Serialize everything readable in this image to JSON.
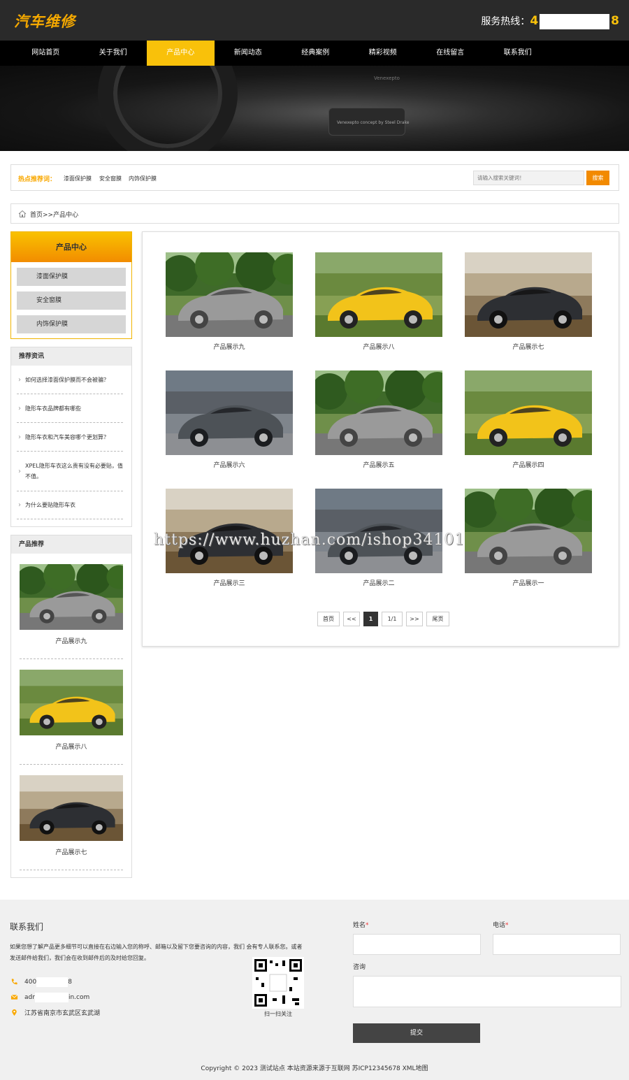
{
  "header": {
    "logo": "汽车维修",
    "hotline_label": "服务热线：",
    "hotline_start": "4",
    "hotline_end": "8"
  },
  "nav": {
    "items": [
      "网站首页",
      "关于我们",
      "产品中心",
      "新闻动态",
      "经典案例",
      "精彩视频",
      "在线留言",
      "联系我们"
    ],
    "active_index": 2
  },
  "banner": {
    "caption": "Venexepto concept by Steel Drake",
    "caption2": "Venexepto"
  },
  "hot_search": {
    "label": "热点推荐词：",
    "keywords": [
      "漆面保护膜",
      "安全窗膜",
      "内饰保护膜"
    ],
    "search_placeholder": "请输入搜索关键词！",
    "search_button": "搜索"
  },
  "breadcrumb": {
    "text": "首页>>产品中心"
  },
  "sidebar": {
    "category_title": "产品中心",
    "categories": [
      "漆面保护膜",
      "安全窗膜",
      "内饰保护膜"
    ],
    "news_title": "推荐资讯",
    "news": [
      "如何选择漆面保护膜而不会被骗？",
      "隐形车衣品牌都有哪些",
      "隐形车衣和汽车美容哪个更划算？",
      "XPEL隐形车衣这么贵有没有必要贴，值不值。",
      "为什么要贴隐形车衣"
    ],
    "products_title": "产品推荐",
    "products": [
      {
        "name": "产品展示九",
        "car": "silver-mercedes"
      },
      {
        "name": "产品展示八",
        "car": "yellow-lamborghini"
      },
      {
        "name": "产品展示七",
        "car": "black-audi"
      }
    ]
  },
  "products": [
    {
      "name": "产品展示九",
      "car": "silver-mercedes"
    },
    {
      "name": "产品展示八",
      "car": "yellow-lamborghini"
    },
    {
      "name": "产品展示七",
      "car": "black-audi"
    },
    {
      "name": "产品展示六",
      "car": "grey-maserati"
    },
    {
      "name": "产品展示五",
      "car": "silver-mercedes"
    },
    {
      "name": "产品展示四",
      "car": "yellow-lamborghini"
    },
    {
      "name": "产品展示三",
      "car": "black-audi"
    },
    {
      "name": "产品展示二",
      "car": "grey-maserati"
    },
    {
      "name": "产品展示一",
      "car": "silver-mercedes"
    }
  ],
  "pager": {
    "first": "首页",
    "prev": "<<",
    "current": "1",
    "total": "1/1",
    "next": ">>",
    "last": "尾页"
  },
  "watermark": "https://www.huzhan.com/ishop34101",
  "footer": {
    "title": "联系我们",
    "desc": "如果您想了解产品更多细节可以直接在右边输入您的称呼、邮箱以及留下您要咨询的内容，我们 会有专人联系您。或者发送邮件给我们，我们会在收到邮件后的及时给您回复。",
    "phone_start": "400",
    "phone_end": "8",
    "email_start": "adr",
    "email_end": "in.com",
    "address": "江苏省南京市玄武区玄武湖",
    "qr_caption": "扫一扫关注",
    "form": {
      "name_label": "姓名",
      "phone_label": "电话",
      "required_mark": "*",
      "message_label": "咨询",
      "submit": "提交"
    },
    "copyright": "Copyright © 2023 测试站点 本站资源来源于互联网 苏ICP12345678 XML地图"
  },
  "colors": {
    "accent": "#f9c10a",
    "orange": "#f28a00",
    "header_bg": "#2a2a2a",
    "nav_bg": "#000000"
  }
}
